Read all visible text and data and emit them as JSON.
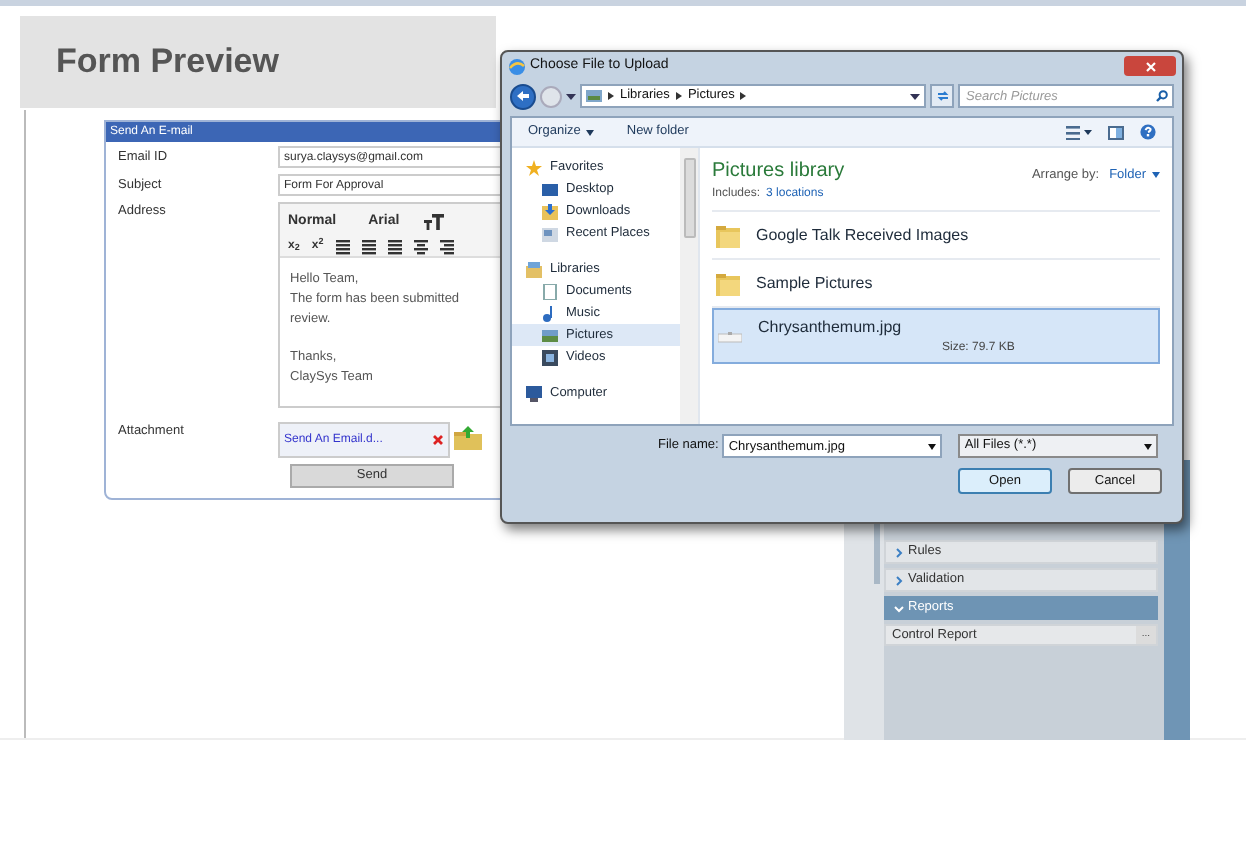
{
  "page_title": "Form Preview",
  "email_form": {
    "title": "Send An E-mail",
    "fields": [
      {
        "label": "Email ID",
        "value": "surya.claysys@gmail.com"
      },
      {
        "label": "Subject",
        "value": "Form For Approval"
      }
    ],
    "address_label": "Address",
    "editor": {
      "format": "Normal",
      "font": "Arial",
      "script_buttons": [
        "x$_{2}$",
        "x$^{2}$"
      ],
      "paragraphs": [
        "Hello Team,\nThe form has been submitted\nreview.",
        "Thanks,\nClaySys Team"
      ]
    },
    "attachment_label": "Attachment",
    "attachment_file": "Send An Email.d...",
    "send_button": "Send"
  },
  "properties_panel": {
    "sections": [
      {
        "label": "Rules",
        "expanded": false
      },
      {
        "label": "Validation",
        "expanded": false
      },
      {
        "label": "Reports",
        "expanded": true
      }
    ],
    "rows": [
      {
        "label": "Control Report",
        "button": "..."
      }
    ]
  },
  "dialog": {
    "title": "Choose File to Upload",
    "breadcrumbs": [
      "Libraries",
      "Pictures"
    ],
    "search_placeholder": "Search Pictures",
    "toolbar": [
      "Organize",
      "New folder"
    ],
    "nav": [
      {
        "label": "Favorites",
        "kind": "star",
        "selected": false,
        "children": [
          {
            "label": "Desktop",
            "kind": "desktop",
            "selected": false
          },
          {
            "label": "Downloads",
            "kind": "download",
            "selected": false
          },
          {
            "label": "Recent Places",
            "kind": "recent",
            "selected": false
          }
        ]
      },
      {
        "label": "Libraries",
        "kind": "library",
        "selected": false,
        "children": [
          {
            "label": "Documents",
            "kind": "document",
            "selected": false
          },
          {
            "label": "Music",
            "kind": "music",
            "selected": false
          },
          {
            "label": "Pictures",
            "kind": "pictures",
            "selected": true
          },
          {
            "label": "Videos",
            "kind": "video",
            "selected": false
          }
        ]
      },
      {
        "label": "Computer",
        "kind": "computer",
        "selected": false
      }
    ],
    "library_title": "Pictures library",
    "includes_label": "Includes:",
    "includes_link": "3 locations",
    "arrange_label": "Arrange by:",
    "arrange_value": "Folder",
    "items": [
      {
        "name": "Google Talk Received Images",
        "kind": "folder",
        "selected": false
      },
      {
        "name": "Sample Pictures",
        "kind": "folder",
        "selected": false
      },
      {
        "name": "Chrysanthemum.jpg",
        "kind": "file",
        "size": "Size: 79.7 KB",
        "selected": true
      }
    ],
    "file_name_label": "File name:",
    "file_name": "Chrysanthemum.jpg",
    "file_type": "All Files (*.*)",
    "buttons": [
      "Open",
      "Cancel"
    ]
  }
}
